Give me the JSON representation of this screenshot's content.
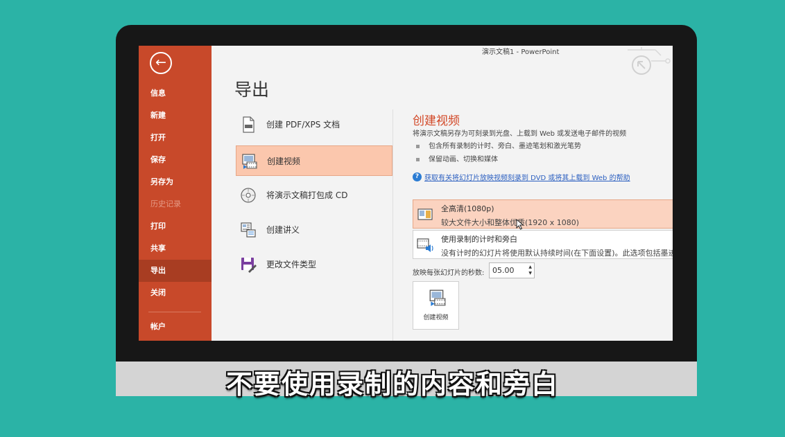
{
  "window": {
    "title": "演示文稿1  -  PowerPoint"
  },
  "sidebar": {
    "items": [
      {
        "label": "信息",
        "state": "normal"
      },
      {
        "label": "新建",
        "state": "normal"
      },
      {
        "label": "打开",
        "state": "normal"
      },
      {
        "label": "保存",
        "state": "normal"
      },
      {
        "label": "另存为",
        "state": "normal"
      },
      {
        "label": "历史记录",
        "state": "disabled"
      },
      {
        "label": "打印",
        "state": "normal"
      },
      {
        "label": "共享",
        "state": "normal"
      },
      {
        "label": "导出",
        "state": "active"
      },
      {
        "label": "关闭",
        "state": "normal"
      },
      {
        "label": "帐户",
        "state": "normal"
      }
    ]
  },
  "page": {
    "title": "导出"
  },
  "export_options": [
    {
      "label": "创建 PDF/XPS 文档",
      "icon": "pdf-document-icon"
    },
    {
      "label": "创建视频",
      "icon": "video-icon"
    },
    {
      "label": "将演示文稿打包成 CD",
      "icon": "cd-icon"
    },
    {
      "label": "创建讲义",
      "icon": "handout-icon"
    },
    {
      "label": "更改文件类型",
      "icon": "file-type-icon"
    }
  ],
  "detail": {
    "title": "创建视频",
    "description": "将演示文稿另存为可刻录到光盘、上载到 Web 或发送电子邮件的视频",
    "bullets": [
      "包含所有录制的计时、旁白、墨迹笔划和激光笔势",
      "保留动画、切换和媒体"
    ],
    "help_link": "获取有关将幻灯片放映视频刻录到 DVD 或将其上载到 Web 的帮助",
    "quality": {
      "title": "全高清(1080p)",
      "subtitle": "较大文件大小和整体优质(1920 x 1080)"
    },
    "timing": {
      "title": "使用录制的计时和旁白",
      "subtitle": "没有计时的幻灯片将使用默认持续时间(在下面设置)。此选项包括墨迹和"
    },
    "seconds_label": "放映每张幻灯片的秒数:",
    "seconds_value": "05.00",
    "create_button": "创建视频"
  },
  "subtitle": "不要使用录制的内容和旁白",
  "colors": {
    "accent": "#c8492a",
    "active_nav": "#a83d22",
    "selected": "#fbc7ad",
    "background": "#2bb3a6"
  }
}
